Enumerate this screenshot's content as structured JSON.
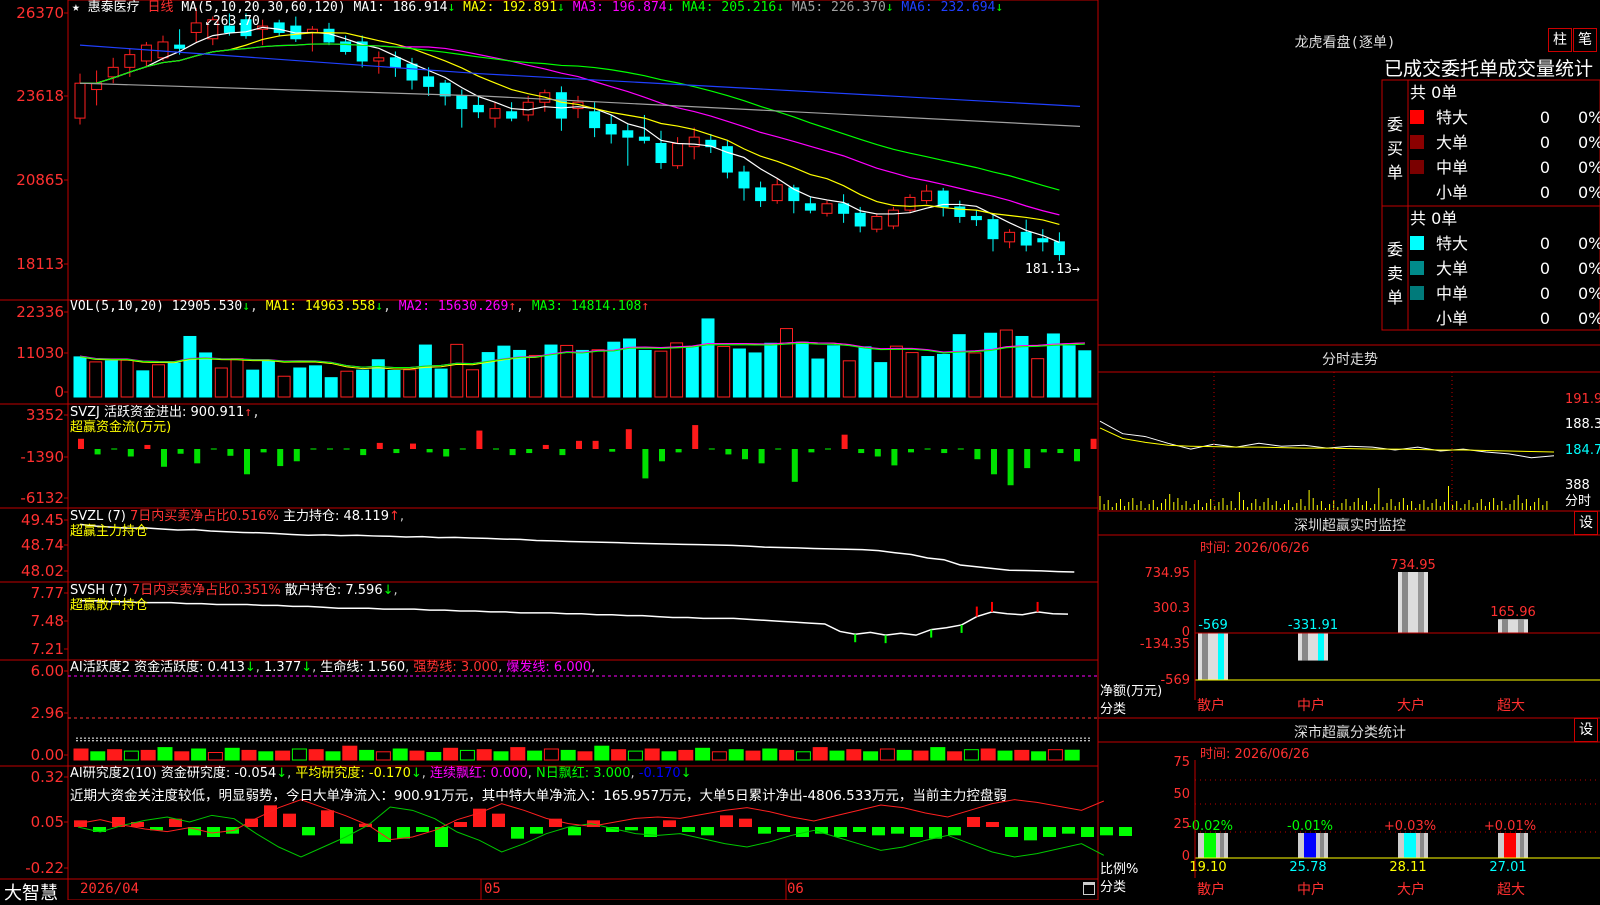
{
  "app": {
    "name": "大智慧"
  },
  "stock": {
    "name": "惠泰医疗",
    "period": "日线",
    "star": "★"
  },
  "colors": {
    "up": "#ff2020",
    "down": "#00ffff",
    "grid": "#c00000",
    "ma1": "#ffffff",
    "ma2": "#ffff00",
    "ma3": "#ff00ff",
    "ma4": "#00ff00",
    "ma5": "#a0a0a0",
    "ma6": "#2040ff"
  },
  "main_pane": {
    "ma_params": "MA(5,10,20,30,60,120)",
    "ma_items": [
      {
        "label": "MA1: 186.914",
        "arrow": "↓",
        "color": "#ffffff"
      },
      {
        "label": "MA2: 192.891",
        "arrow": "↓",
        "color": "#ffff00"
      },
      {
        "label": "MA3: 196.874",
        "arrow": "↓",
        "color": "#ff00ff"
      },
      {
        "label": "MA4: 205.216",
        "arrow": "↓",
        "color": "#00ff00"
      },
      {
        "label": "MA5: 226.370",
        "arrow": "↓",
        "color": "#a0a0a0"
      },
      {
        "label": "MA6: 232.694",
        "arrow": "↓",
        "color": "#2040ff"
      }
    ],
    "high_note": "263.70",
    "low_note": "181.13",
    "axis": [
      "26370",
      "23618",
      "20865",
      "18113"
    ]
  },
  "vol_pane": {
    "params": "VOL(5,10,20)",
    "value": "12905.530",
    "arrow0": "↓",
    "ma1": "MA1: 14963.558",
    "ma1_arrow": "↓",
    "ma2": "MA2: 15630.269",
    "ma2_arrow": "↑",
    "ma3": "MA3: 14814.108",
    "ma3_arrow": "↑",
    "axis": [
      "22336",
      "11030",
      "0"
    ]
  },
  "svzj_pane": {
    "line1": "SVZJ  活跃资金进出: 900.911",
    "arrow1": "↑",
    "line2": "超赢资金流(万元)",
    "axis": [
      "3352",
      "-1390",
      "-6132"
    ]
  },
  "svzl_pane": {
    "p1": "SVZL (7)",
    "p2": "7日内买卖净占比0.516%",
    "p3": "主力持仓: 48.119",
    "arrow": "↑",
    "line2": "超赢主力持仓",
    "axis": [
      "49.45",
      "48.74",
      "48.02"
    ]
  },
  "svsh_pane": {
    "p1": "SVSH (7)",
    "p2": "7日内买卖净占比0.351%",
    "p3": "散户持仓: 7.596",
    "arrow": "↓",
    "line2": "超赢散户持仓",
    "axis": [
      "7.77",
      "7.48",
      "7.21"
    ]
  },
  "ai1_pane": {
    "p1": "AI活跃度2 资金活跃度: 0.413",
    "a1": "↓",
    "p2": "1.377",
    "p3": "生命线: 1.560",
    "p4": "强势线: 3.000",
    "p5": "爆发线: 6.000",
    "axis": [
      "6.00",
      "2.96",
      "0.00"
    ]
  },
  "ai2_pane": {
    "p1": "AI研究度2(10) 资金研究度: -0.054",
    "a1": "↓",
    "p2": "平均研究度: -0.170",
    "a2": "↓",
    "p3": "连续飘红: 0.000",
    "p4": "N日飘红: 3.000",
    "p5": "-0.170",
    "a5": "↓",
    "comment": "近期大资金关注度较低，明显弱势，今日大单净流入：900.91万元，其中特大单净流入：165.957万元，大单5日累计净出-4806.533万元，当前主力控盘弱",
    "axis": [
      "0.32",
      "0.05",
      "-0.22"
    ]
  },
  "date_axis": [
    "2026/04",
    "05",
    "06"
  ],
  "dragon_tiger": {
    "title": "龙虎看盘(逐单)",
    "btn1": "柱",
    "btn2": "笔",
    "header": "已成交委托单成交量统计",
    "buy": {
      "label": "委买单",
      "total": "共 0单",
      "rows": [
        {
          "name": "特大",
          "count": "0",
          "pct": "0%",
          "color": "#ff0000"
        },
        {
          "name": "大单",
          "count": "0",
          "pct": "0%",
          "color": "#8b0000"
        },
        {
          "name": "中单",
          "count": "0",
          "pct": "0%",
          "color": "#7a0000"
        },
        {
          "name": "小单",
          "count": "0",
          "pct": "0%",
          "color": "#000000"
        }
      ]
    },
    "sell": {
      "label": "委卖单",
      "total": "共 0单",
      "rows": [
        {
          "name": "特大",
          "count": "0",
          "pct": "0%",
          "color": "#00ffff"
        },
        {
          "name": "大单",
          "count": "0",
          "pct": "0%",
          "color": "#008b8b"
        },
        {
          "name": "中单",
          "count": "0",
          "pct": "0%",
          "color": "#007a7a"
        },
        {
          "name": "小单",
          "count": "0",
          "pct": "0%",
          "color": "#000000"
        }
      ]
    }
  },
  "intraday": {
    "title": "分时走势",
    "axis": [
      "191.9",
      "188.3",
      "184.7",
      "388",
      "分时"
    ]
  },
  "monitor": {
    "title": "深圳超赢实时监控",
    "btn": "设",
    "time": "时间: 2026/06/26",
    "axis": [
      "734.95",
      "300.3",
      "0",
      "-134.35",
      "-569"
    ],
    "ylabel": "净额(万元)",
    "xlabel": "分类",
    "categories": [
      "散户",
      "中户",
      "大户",
      "超大"
    ]
  },
  "classify": {
    "title": "深市超赢分类统计",
    "btn": "设",
    "time": "时间: 2026/06/26",
    "axis": [
      "75",
      "50",
      "25",
      "0"
    ],
    "ylabel": "比例%",
    "xlabel": "分类",
    "categories": [
      "散户",
      "中户",
      "大户",
      "超大"
    ]
  },
  "chart_data": [
    {
      "type": "candlestick",
      "label": "惠泰医疗 日线",
      "ylim": [
        181.13,
        263.7
      ],
      "high": 263.7,
      "low": 181.13,
      "ohlc": [
        [
          229,
          243,
          227,
          240
        ],
        [
          238,
          244,
          233,
          240
        ],
        [
          242,
          248,
          240,
          245
        ],
        [
          245,
          251,
          242,
          249
        ],
        [
          247,
          253,
          245,
          252
        ],
        [
          248,
          255,
          247,
          253
        ],
        [
          252,
          257,
          249,
          251
        ],
        [
          256,
          263.7,
          253,
          259
        ],
        [
          254,
          261,
          252,
          260
        ],
        [
          258,
          262,
          255,
          256
        ],
        [
          260,
          262,
          254,
          255
        ],
        [
          257,
          260,
          252,
          258
        ],
        [
          259,
          260,
          255,
          256
        ],
        [
          258,
          261,
          253,
          254
        ],
        [
          256,
          258,
          250,
          257
        ],
        [
          257,
          259,
          252,
          253
        ],
        [
          253,
          255,
          249,
          250
        ],
        [
          253,
          255,
          245,
          247
        ],
        [
          247,
          250,
          243,
          248
        ],
        [
          248,
          250,
          242,
          245
        ],
        [
          246,
          248,
          238,
          241
        ],
        [
          242,
          245,
          236,
          239
        ],
        [
          240,
          241,
          233,
          236
        ],
        [
          236,
          238,
          226,
          232
        ],
        [
          233,
          236,
          229,
          231
        ],
        [
          229,
          234,
          226,
          232
        ],
        [
          231,
          234,
          228,
          229
        ],
        [
          230,
          236,
          228,
          234
        ],
        [
          234,
          238,
          231,
          237
        ],
        [
          237,
          239,
          225,
          229
        ],
        [
          232,
          236,
          229,
          234
        ],
        [
          231,
          234,
          223,
          226
        ],
        [
          227,
          230,
          221,
          224
        ],
        [
          225,
          227,
          214,
          223
        ],
        [
          223,
          230,
          221,
          222
        ],
        [
          221,
          225,
          213,
          215
        ],
        [
          214,
          223,
          213,
          221
        ],
        [
          220,
          226,
          216,
          223
        ],
        [
          222,
          224,
          218,
          220
        ],
        [
          220,
          222,
          210,
          212
        ],
        [
          212,
          214,
          203,
          207
        ],
        [
          207,
          209,
          201,
          203
        ],
        [
          203,
          210,
          202,
          208
        ],
        [
          207,
          208,
          199,
          203
        ],
        [
          202,
          204,
          199,
          200
        ],
        [
          199,
          203,
          198,
          202
        ],
        [
          202,
          205,
          196,
          199
        ],
        [
          199,
          201,
          193,
          195
        ],
        [
          194,
          199,
          193,
          198
        ],
        [
          195,
          201,
          194,
          200
        ],
        [
          200,
          205,
          199,
          204
        ],
        [
          203,
          208,
          202,
          206
        ],
        [
          206,
          207,
          198,
          201
        ],
        [
          201,
          203,
          196,
          198
        ],
        [
          198,
          200,
          195,
          197
        ],
        [
          197,
          199,
          187,
          191
        ],
        [
          190,
          194,
          188,
          193
        ],
        [
          193,
          197,
          187,
          189
        ],
        [
          191,
          194,
          187,
          190
        ],
        [
          190,
          193,
          184,
          186
        ]
      ],
      "ma_last": {
        "MA1": 186.914,
        "MA2": 192.891,
        "MA3": 196.874,
        "MA4": 205.216,
        "MA5": 226.37,
        "MA6": 232.694
      }
    },
    {
      "type": "bar",
      "label": "VOL(5,10,20)",
      "ylim": [
        0,
        22336
      ],
      "values": [
        11200,
        9800,
        10100,
        10300,
        7300,
        9000,
        9500,
        16900,
        12300,
        8100,
        10700,
        7500,
        10200,
        5800,
        8100,
        8700,
        5400,
        7200,
        7500,
        10400,
        7400,
        7600,
        14500,
        7800,
        14700,
        7600,
        12400,
        14200,
        13000,
        11600,
        14500,
        14400,
        13000,
        13200,
        15300,
        16200,
        13000,
        12800,
        15100,
        14000,
        21800,
        14100,
        13400,
        12300,
        15000,
        19100,
        15300,
        10600,
        14300,
        10100,
        14000,
        9600,
        14200,
        12400,
        11300,
        11900,
        17400,
        12300,
        17800,
        18700,
        16900,
        10700,
        17600,
        14300,
        12900
      ]
    },
    {
      "type": "bar",
      "label": "超赢资金流(万元)",
      "ylim": [
        -6132,
        3352
      ],
      "values": [
        1200,
        -500,
        0,
        -800,
        300,
        -2300,
        -400,
        -1800,
        0,
        -700,
        -3400,
        -200,
        -2200,
        -1500,
        0,
        0,
        0,
        -600,
        600,
        -300,
        500,
        -200,
        -800,
        0,
        2400,
        0,
        -600,
        -300,
        300,
        -600,
        900,
        900,
        -100,
        2600,
        -4000,
        -1500,
        -200,
        3200,
        0,
        -500,
        -1200,
        -1800,
        0,
        -4500,
        -200,
        0,
        1800,
        -300,
        -800,
        -2100,
        -200,
        0,
        -300,
        0,
        -1200,
        -3400,
        -5000,
        -2500,
        -200,
        -300,
        -1500,
        1200
      ]
    },
    {
      "type": "line",
      "label": "超赢主力持仓",
      "ylim": [
        48.02,
        49.45
      ],
      "values": [
        49.41,
        49.36,
        49.33,
        49.3,
        49.31,
        49.28,
        49.25,
        49.26,
        49.22,
        49.2,
        49.18,
        49.17,
        49.15,
        49.12,
        49.1,
        49.11,
        49.09,
        49.1,
        49.08,
        49.07,
        49.05,
        49.06,
        49.03,
        49.04,
        49.02,
        49.01,
        48.99,
        48.98,
        48.95,
        48.94,
        48.92,
        48.91,
        48.9,
        48.89,
        48.87,
        48.86,
        48.85,
        48.84,
        48.83,
        48.82,
        48.81,
        48.79,
        48.76,
        48.75,
        48.74,
        48.72,
        48.71,
        48.7,
        48.69,
        48.66,
        48.6,
        48.55,
        48.45,
        48.4,
        48.25,
        48.2,
        48.15,
        48.1,
        48.09,
        48.08,
        48.06,
        48.05
      ]
    },
    {
      "type": "line",
      "label": "超赢散户持仓",
      "ylim": [
        7.21,
        7.77
      ],
      "values": [
        7.74,
        7.74,
        7.73,
        7.73,
        7.72,
        7.72,
        7.72,
        7.71,
        7.71,
        7.7,
        7.7,
        7.7,
        7.69,
        7.69,
        7.68,
        7.68,
        7.67,
        7.66,
        7.66,
        7.66,
        7.65,
        7.65,
        7.65,
        7.64,
        7.64,
        7.63,
        7.63,
        7.62,
        7.62,
        7.61,
        7.61,
        7.61,
        7.6,
        7.6,
        7.59,
        7.59,
        7.58,
        7.58,
        7.57,
        7.56,
        7.56,
        7.55,
        7.55,
        7.55,
        7.54,
        7.53,
        7.52,
        7.51,
        7.5,
        7.49,
        7.41,
        7.38,
        7.4,
        7.37,
        7.39,
        7.37,
        7.43,
        7.45,
        7.48,
        7.57,
        7.62,
        7.6,
        7.59,
        7.62,
        7.6,
        7.596
      ]
    },
    {
      "type": "bar",
      "label": "AI活跃度2",
      "ylim": [
        0,
        6
      ],
      "values": [
        0.5,
        0.3,
        0.45,
        0.35,
        0.4,
        0.6,
        0.3,
        0.5,
        0.25,
        0.55,
        0.4,
        0.3,
        0.35,
        0.5,
        0.45,
        0.3,
        0.7,
        0.4,
        0.3,
        0.5,
        0.35,
        0.25,
        0.55,
        0.4,
        0.45,
        0.3,
        0.6,
        0.35,
        0.5,
        0.4,
        0.3,
        0.7,
        0.45,
        0.35,
        0.5,
        0.3,
        0.4,
        0.55,
        0.3,
        0.45,
        0.35,
        0.5,
        0.4,
        0.3,
        0.6,
        0.35,
        0.45,
        0.3,
        0.5,
        0.4,
        0.35,
        0.6,
        0.3,
        0.45,
        0.5,
        0.35,
        0.4,
        0.3,
        0.45,
        0.413
      ],
      "lines": {
        "生命线": 1.56,
        "强势线": 3.0,
        "爆发线": 6.0,
        "1.377": 1.377
      }
    },
    {
      "type": "bar",
      "label": "AI研究度2(10)",
      "ylim": [
        -0.22,
        0.32
      ],
      "values": [
        0.04,
        -0.03,
        0.06,
        0.03,
        -0.02,
        0.05,
        -0.05,
        -0.06,
        -0.04,
        0.05,
        0.13,
        0.08,
        -0.05,
        0.1,
        -0.1,
        0.02,
        -0.09,
        -0.07,
        -0.03,
        -0.12,
        0.03,
        0.11,
        0.08,
        -0.07,
        -0.04,
        0.05,
        -0.05,
        0.04,
        -0.03,
        -0.02,
        -0.06,
        0.04,
        -0.03,
        -0.05,
        0.07,
        0.05,
        -0.04,
        -0.03,
        -0.06,
        -0.04,
        -0.06,
        -0.03,
        -0.05,
        -0.04,
        -0.06,
        -0.07,
        -0.05,
        0.06,
        0.03,
        -0.06,
        -0.08,
        -0.06,
        -0.04,
        -0.06,
        -0.05,
        -0.054
      ],
      "avg": [
        0.0,
        -0.03,
        0.01,
        0.04,
        0.06,
        0.03,
        0.07,
        0.05,
        -0.04,
        -0.12,
        -0.18,
        -0.12,
        -0.06,
        0.01,
        0.12,
        0.1,
        0.05,
        -0.03,
        -0.08,
        -0.15,
        -0.1,
        -0.04,
        0.0,
        0.02,
        -0.01,
        -0.04,
        -0.05,
        -0.04,
        -0.07,
        -0.1,
        -0.12,
        -0.09,
        -0.05,
        -0.02,
        -0.06,
        -0.1,
        -0.14,
        -0.12,
        -0.08,
        -0.05,
        -0.1,
        -0.15,
        -0.18,
        -0.16,
        -0.13,
        -0.1,
        -0.17
      ]
    },
    {
      "type": "line",
      "label": "分时走势",
      "ylim": [
        181.5,
        191.9
      ],
      "values": [
        187.2,
        185.9,
        185.6,
        184.9,
        184.3,
        184.8,
        184.5,
        184.9,
        184.6,
        184.7,
        184.4,
        184.6,
        184.5,
        184.2,
        184.5,
        184.1,
        184.3,
        184.0,
        183.8,
        183.4,
        183.6
      ],
      "avg": [
        186.5,
        185.4,
        185.0,
        184.7,
        184.6,
        184.55,
        184.5,
        184.5,
        184.45,
        184.4,
        184.4,
        184.35,
        184.3,
        184.3,
        184.25,
        184.2,
        184.2,
        184.15,
        184.1,
        184.05,
        184.0
      ]
    },
    {
      "type": "bar",
      "label": "深圳超赢实时监控",
      "categories": [
        "散户",
        "中户",
        "大户",
        "超大"
      ],
      "values": [
        -569,
        -331.91,
        734.95,
        165.96
      ],
      "ylim": [
        -569,
        734.95
      ]
    },
    {
      "type": "bar",
      "label": "深市超赢分类统计",
      "categories": [
        "散户",
        "中户",
        "大户",
        "超大"
      ],
      "values": [
        19.1,
        25.78,
        28.11,
        27.01
      ],
      "changes": [
        "-0.02%",
        "-0.01%",
        "+0.03%",
        "+0.01%"
      ],
      "ylim": [
        0,
        75
      ]
    }
  ]
}
